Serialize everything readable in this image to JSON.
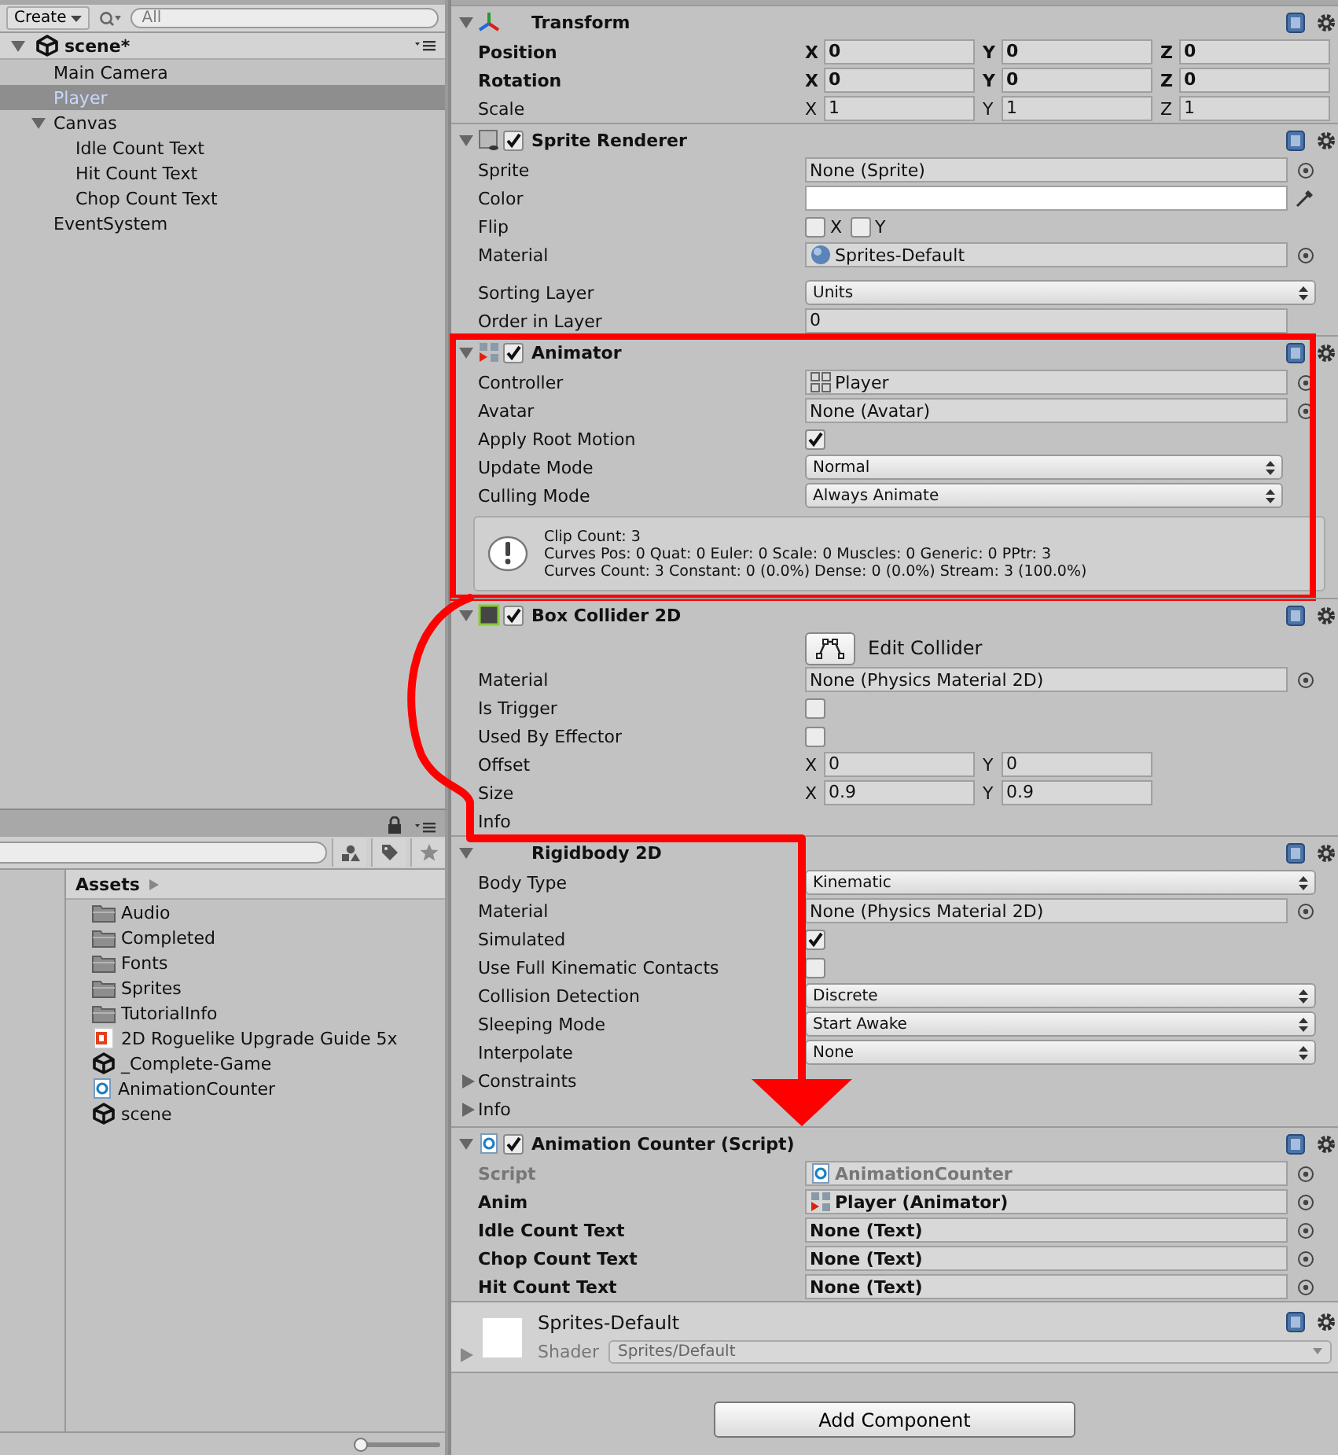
{
  "hierarchy": {
    "create_button": "Create",
    "search_placeholder": "All",
    "scene": {
      "name": "scene*",
      "expanded": true
    },
    "items": [
      {
        "label": "Main Camera",
        "selected": false
      },
      {
        "label": "Player",
        "selected": true
      },
      {
        "label": "Canvas",
        "selected": false,
        "expanded": true,
        "children": [
          {
            "label": "Idle Count Text",
            "selected": false
          },
          {
            "label": "Hit Count Text",
            "selected": false
          },
          {
            "label": "Chop Count Text",
            "selected": false
          }
        ]
      },
      {
        "label": "EventSystem",
        "selected": false
      }
    ]
  },
  "project": {
    "breadcrumb": "Assets",
    "items": [
      {
        "label": "Audio",
        "kind": "folder"
      },
      {
        "label": "Completed",
        "kind": "folder"
      },
      {
        "label": "Fonts",
        "kind": "folder"
      },
      {
        "label": "Sprites",
        "kind": "folder"
      },
      {
        "label": "TutorialInfo",
        "kind": "folder"
      },
      {
        "label": "2D Roguelike Upgrade Guide 5x",
        "kind": "pdf"
      },
      {
        "label": "_Complete-Game",
        "kind": "scene"
      },
      {
        "label": "AnimationCounter",
        "kind": "script"
      },
      {
        "label": "scene",
        "kind": "scene"
      }
    ],
    "icon_size_slider": {
      "level": 0.05
    }
  },
  "inspector": {
    "components": [
      {
        "title": "Transform",
        "kind": "transform",
        "expanded": true,
        "outlined": false,
        "properties": [
          {
            "label": "Position",
            "kind": "vector",
            "bold": true,
            "axes": [
              {
                "axis": "X",
                "value": "0"
              },
              {
                "axis": "Y",
                "value": "0"
              },
              {
                "axis": "Z",
                "value": "0"
              }
            ]
          },
          {
            "label": "Rotation",
            "kind": "vector",
            "bold": true,
            "axes": [
              {
                "axis": "X",
                "value": "0"
              },
              {
                "axis": "Y",
                "value": "0"
              },
              {
                "axis": "Z",
                "value": "0"
              }
            ]
          },
          {
            "label": "Scale",
            "kind": "vector",
            "bold": false,
            "axes": [
              {
                "axis": "X",
                "value": "1"
              },
              {
                "axis": "Y",
                "value": "1"
              },
              {
                "axis": "Z",
                "value": "1"
              }
            ]
          }
        ]
      },
      {
        "title": "Sprite Renderer",
        "kind": "sprite",
        "enabled": true,
        "expanded": true,
        "outlined": false,
        "properties": [
          {
            "label": "Sprite",
            "kind": "object",
            "value": "None (Sprite)"
          },
          {
            "label": "Color",
            "kind": "color"
          },
          {
            "label": "Flip",
            "kind": "toggles",
            "options": [
              {
                "label": "X",
                "checked": false
              },
              {
                "label": "Y",
                "checked": false
              }
            ]
          },
          {
            "label": "Material",
            "kind": "object",
            "value": "Sprites-Default",
            "asset": {
              "kind": "material"
            }
          },
          {
            "kind": "spacer"
          },
          {
            "label": "Sorting Layer",
            "kind": "dropdown",
            "value": "Units"
          },
          {
            "label": "Order in Layer",
            "kind": "text",
            "value": "0"
          }
        ]
      },
      {
        "title": "Animator",
        "kind": "animator",
        "enabled": true,
        "expanded": true,
        "outlined": true,
        "properties": [
          {
            "label": "Controller",
            "kind": "object",
            "value": "Player",
            "asset": {
              "kind": "controller"
            }
          },
          {
            "label": "Avatar",
            "kind": "object",
            "value": "None (Avatar)"
          },
          {
            "label": "Apply Root Motion",
            "kind": "checkbox",
            "checked": true
          },
          {
            "label": "Update Mode",
            "kind": "dropdown",
            "value": "Normal"
          },
          {
            "label": "Culling Mode",
            "kind": "dropdown",
            "value": "Always Animate"
          },
          {
            "kind": "info",
            "lines": [
              "Clip Count: 3",
              "Curves Pos: 0 Quat: 0 Euler: 0 Scale: 0 Muscles: 0 Generic: 0 PPtr: 3",
              "Curves Count: 3 Constant: 0 (0.0%) Dense: 0 (0.0%) Stream: 3 (100.0%)"
            ]
          }
        ]
      },
      {
        "title": "Box Collider 2D",
        "kind": "collider",
        "enabled": true,
        "expanded": true,
        "outlined": false,
        "properties": [
          {
            "kind": "button",
            "label": "Edit Collider"
          },
          {
            "label": "Material",
            "kind": "object",
            "value": "None (Physics Material 2D)"
          },
          {
            "label": "Is Trigger",
            "kind": "checkbox",
            "checked": false
          },
          {
            "label": "Used By Effector",
            "kind": "checkbox",
            "checked": false
          },
          {
            "label": "Offset",
            "kind": "vector",
            "axes": [
              {
                "axis": "X",
                "value": "0"
              },
              {
                "axis": "Y",
                "value": "0"
              }
            ]
          },
          {
            "label": "Size",
            "kind": "vector",
            "axes": [
              {
                "axis": "X",
                "value": "0.9"
              },
              {
                "axis": "Y",
                "value": "0.9"
              }
            ]
          },
          {
            "label": "Info",
            "kind": "label"
          }
        ]
      },
      {
        "title": "Rigidbody 2D",
        "expanded": true,
        "outlined": false,
        "properties": [
          {
            "label": "Body Type",
            "kind": "dropdown",
            "value": "Kinematic"
          },
          {
            "label": "Material",
            "kind": "object",
            "value": "None (Physics Material 2D)"
          },
          {
            "label": "Simulated",
            "kind": "checkbox",
            "checked": true
          },
          {
            "label": "Use Full Kinematic Contacts",
            "kind": "checkbox",
            "checked": false
          },
          {
            "label": "Collision Detection",
            "kind": "dropdown",
            "value": "Discrete"
          },
          {
            "label": "Sleeping Mode",
            "kind": "dropdown",
            "value": "Start Awake"
          },
          {
            "label": "Interpolate",
            "kind": "dropdown",
            "value": "None"
          },
          {
            "label": "Constraints",
            "kind": "foldout",
            "expanded": false
          },
          {
            "label": "Info",
            "kind": "foldout",
            "expanded": false
          }
        ]
      },
      {
        "title": "Animation Counter (Script)",
        "kind": "script",
        "enabled": true,
        "expanded": true,
        "outlined": false,
        "properties": [
          {
            "label": "Script",
            "kind": "object",
            "value": "AnimationCounter",
            "asset": {
              "kind": "script"
            },
            "bold": true,
            "disabled": true
          },
          {
            "label": "Anim",
            "kind": "object",
            "value": "Player (Animator)",
            "asset": {
              "kind": "animator"
            },
            "bold": true,
            "disabled": false
          },
          {
            "label": "Idle Count Text",
            "kind": "object",
            "value": "None (Text)",
            "bold": true,
            "disabled": false
          },
          {
            "label": "Chop Count Text",
            "kind": "object",
            "value": "None (Text)",
            "bold": true,
            "disabled": false
          },
          {
            "label": "Hit Count Text",
            "kind": "object",
            "value": "None (Text)",
            "bold": true,
            "disabled": false
          }
        ]
      }
    ],
    "material": {
      "name": "Sprites-Default",
      "expanded": false,
      "shader_label": "Shader",
      "shader": "Sprites/Default"
    },
    "add_component": "Add Component"
  }
}
